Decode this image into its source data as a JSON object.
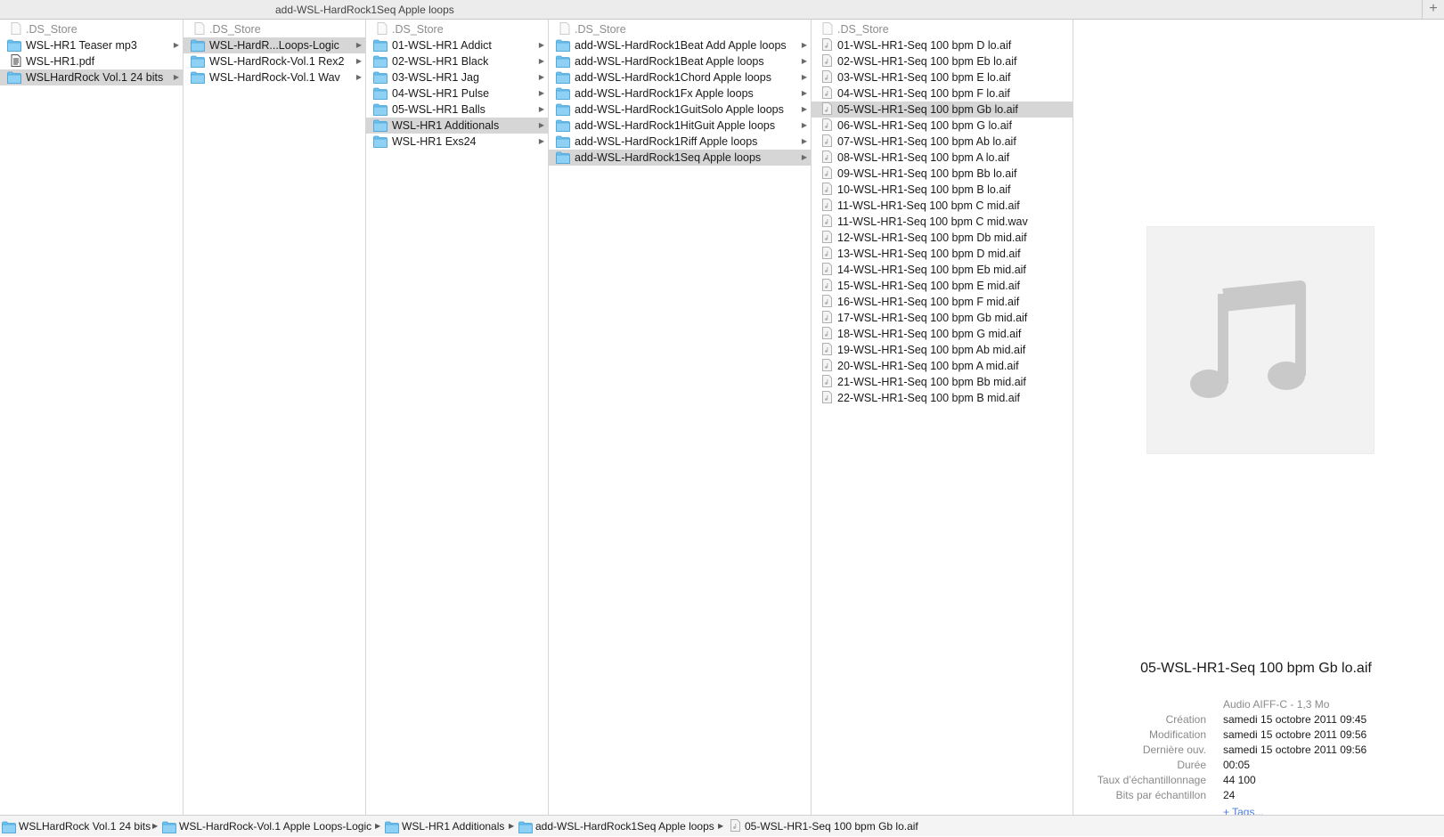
{
  "window": {
    "tab_title": "add-WSL-HardRock1Seq Apple loops",
    "add_tab": "+"
  },
  "columns": [
    {
      "items": [
        {
          "label": ".DS_Store",
          "icon": "document-icon",
          "muted": true
        },
        {
          "label": "WSL-HR1 Teaser mp3",
          "icon": "folder-icon",
          "arrow": true
        },
        {
          "label": "WSL-HR1.pdf",
          "icon": "pdf-icon"
        },
        {
          "label": "WSLHardRock Vol.1 24 bits",
          "icon": "folder-icon",
          "arrow": true,
          "selected": true
        }
      ]
    },
    {
      "items": [
        {
          "label": ".DS_Store",
          "icon": "document-icon",
          "muted": true
        },
        {
          "label": "WSL-HardR...Loops-Logic",
          "icon": "folder-icon",
          "arrow": true,
          "selected": true
        },
        {
          "label": "WSL-HardRock-Vol.1 Rex2",
          "icon": "folder-icon",
          "arrow": true
        },
        {
          "label": "WSL-HardRock-Vol.1 Wav",
          "icon": "folder-icon",
          "arrow": true
        }
      ]
    },
    {
      "items": [
        {
          "label": ".DS_Store",
          "icon": "document-icon",
          "muted": true
        },
        {
          "label": "01-WSL-HR1 Addict",
          "icon": "folder-icon",
          "arrow": true
        },
        {
          "label": "02-WSL-HR1 Black",
          "icon": "folder-icon",
          "arrow": true
        },
        {
          "label": "03-WSL-HR1 Jag",
          "icon": "folder-icon",
          "arrow": true
        },
        {
          "label": "04-WSL-HR1 Pulse",
          "icon": "folder-icon",
          "arrow": true
        },
        {
          "label": "05-WSL-HR1 Balls",
          "icon": "folder-icon",
          "arrow": true
        },
        {
          "label": "WSL-HR1 Additionals",
          "icon": "folder-icon",
          "arrow": true,
          "selected": true
        },
        {
          "label": "WSL-HR1 Exs24",
          "icon": "folder-icon",
          "arrow": true
        }
      ]
    },
    {
      "items": [
        {
          "label": ".DS_Store",
          "icon": "document-icon",
          "muted": true
        },
        {
          "label": "add-WSL-HardRock1Beat Add Apple loops",
          "icon": "folder-icon",
          "arrow": true
        },
        {
          "label": "add-WSL-HardRock1Beat Apple loops",
          "icon": "folder-icon",
          "arrow": true
        },
        {
          "label": "add-WSL-HardRock1Chord Apple loops",
          "icon": "folder-icon",
          "arrow": true
        },
        {
          "label": "add-WSL-HardRock1Fx Apple loops",
          "icon": "folder-icon",
          "arrow": true
        },
        {
          "label": "add-WSL-HardRock1GuitSolo Apple loops",
          "icon": "folder-icon",
          "arrow": true
        },
        {
          "label": "add-WSL-HardRock1HitGuit Apple loops",
          "icon": "folder-icon",
          "arrow": true
        },
        {
          "label": "add-WSL-HardRock1Riff Apple loops",
          "icon": "folder-icon",
          "arrow": true
        },
        {
          "label": "add-WSL-HardRock1Seq Apple loops",
          "icon": "folder-icon",
          "arrow": true,
          "selected": true
        }
      ]
    },
    {
      "items": [
        {
          "label": ".DS_Store",
          "icon": "document-icon",
          "muted": true
        },
        {
          "label": "01-WSL-HR1-Seq 100 bpm D lo.aif",
          "icon": "audio-file-icon"
        },
        {
          "label": "02-WSL-HR1-Seq 100 bpm Eb lo.aif",
          "icon": "audio-file-icon"
        },
        {
          "label": "03-WSL-HR1-Seq 100 bpm E lo.aif",
          "icon": "audio-file-icon"
        },
        {
          "label": "04-WSL-HR1-Seq 100 bpm F lo.aif",
          "icon": "audio-file-icon"
        },
        {
          "label": "05-WSL-HR1-Seq 100 bpm Gb lo.aif",
          "icon": "audio-file-icon",
          "selected": true
        },
        {
          "label": "06-WSL-HR1-Seq 100 bpm G lo.aif",
          "icon": "audio-file-icon"
        },
        {
          "label": "07-WSL-HR1-Seq 100 bpm Ab lo.aif",
          "icon": "audio-file-icon"
        },
        {
          "label": "08-WSL-HR1-Seq 100 bpm A lo.aif",
          "icon": "audio-file-icon"
        },
        {
          "label": "09-WSL-HR1-Seq 100 bpm Bb lo.aif",
          "icon": "audio-file-icon"
        },
        {
          "label": "10-WSL-HR1-Seq 100 bpm B lo.aif",
          "icon": "audio-file-icon"
        },
        {
          "label": "11-WSL-HR1-Seq 100 bpm C mid.aif",
          "icon": "audio-file-icon"
        },
        {
          "label": "11-WSL-HR1-Seq 100 bpm C mid.wav",
          "icon": "audio-file-icon"
        },
        {
          "label": "12-WSL-HR1-Seq 100 bpm Db mid.aif",
          "icon": "audio-file-icon"
        },
        {
          "label": "13-WSL-HR1-Seq 100 bpm D mid.aif",
          "icon": "audio-file-icon"
        },
        {
          "label": "14-WSL-HR1-Seq 100 bpm Eb mid.aif",
          "icon": "audio-file-icon"
        },
        {
          "label": "15-WSL-HR1-Seq 100 bpm E mid.aif",
          "icon": "audio-file-icon"
        },
        {
          "label": "16-WSL-HR1-Seq 100 bpm F mid.aif",
          "icon": "audio-file-icon"
        },
        {
          "label": "17-WSL-HR1-Seq 100 bpm Gb mid.aif",
          "icon": "audio-file-icon"
        },
        {
          "label": "18-WSL-HR1-Seq 100 bpm G mid.aif",
          "icon": "audio-file-icon"
        },
        {
          "label": "19-WSL-HR1-Seq 100 bpm Ab mid.aif",
          "icon": "audio-file-icon"
        },
        {
          "label": "20-WSL-HR1-Seq 100 bpm A mid.aif",
          "icon": "audio-file-icon"
        },
        {
          "label": "21-WSL-HR1-Seq 100 bpm Bb mid.aif",
          "icon": "audio-file-icon"
        },
        {
          "label": "22-WSL-HR1-Seq 100 bpm B mid.aif",
          "icon": "audio-file-icon"
        }
      ]
    }
  ],
  "preview": {
    "icon": "music-note-icon",
    "file_name": "05-WSL-HR1-Seq 100 bpm Gb lo.aif",
    "kind": "Audio AIFF-C - 1,3 Mo",
    "fields": [
      {
        "label": "Création",
        "value": "samedi 15 octobre 2011 09:45"
      },
      {
        "label": "Modification",
        "value": "samedi 15 octobre 2011 09:56"
      },
      {
        "label": "Dernière ouv.",
        "value": "samedi 15 octobre 2011 09:56"
      },
      {
        "label": "Durée",
        "value": "00:05"
      },
      {
        "label": "Taux d’échantillonnage",
        "value": "44 100"
      },
      {
        "label": "Bits par échantillon",
        "value": "24"
      }
    ],
    "tags_link": "+ Tags..."
  },
  "path_bar": [
    {
      "label": "WSLHardRock Vol.1 24 bits",
      "icon": "folder-icon"
    },
    {
      "label": "WSL-HardRock-Vol.1 Apple Loops-Logic",
      "icon": "folder-icon"
    },
    {
      "label": "WSL-HR1 Additionals",
      "icon": "folder-icon"
    },
    {
      "label": "add-WSL-HardRock1Seq Apple loops",
      "icon": "folder-icon"
    },
    {
      "label": "05-WSL-HR1-Seq 100 bpm Gb lo.aif",
      "icon": "audio-file-icon"
    }
  ],
  "colors": {
    "selection": "#d6d6d6",
    "folder": "#6cc2f0",
    "link": "#4a7de0"
  }
}
